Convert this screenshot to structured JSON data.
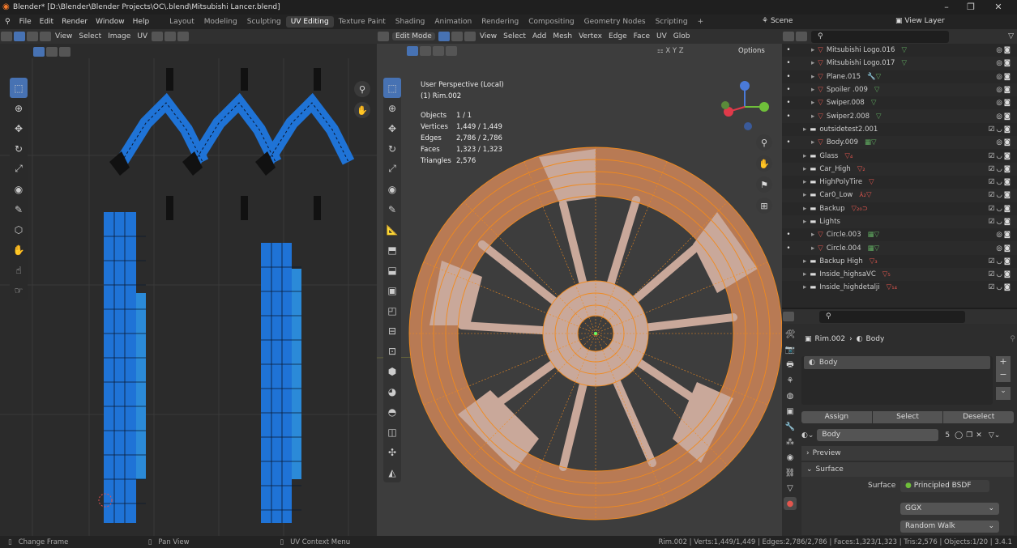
{
  "window": {
    "title": "Blender* [D:\\Blender\\Blender Projects\\OC\\.blend\\Mitsubishi Lancer.blend]",
    "minimize": "–",
    "maximize": "❐",
    "close": "✕"
  },
  "menu": {
    "items": [
      "File",
      "Edit",
      "Render",
      "Window",
      "Help"
    ]
  },
  "workspaces": [
    "Layout",
    "Modeling",
    "Sculpting",
    "UV Editing",
    "Texture Paint",
    "Shading",
    "Animation",
    "Rendering",
    "Compositing",
    "Geometry Nodes",
    "Scripting",
    "+"
  ],
  "scene": {
    "scene_label": "Scene",
    "view_layer_label": "View Layer"
  },
  "uv_editor": {
    "header": [
      "View",
      "Select",
      "Image",
      "UV"
    ]
  },
  "viewport": {
    "mode": "Edit Mode",
    "header": [
      "View",
      "Select",
      "Add",
      "Mesh",
      "Vertex",
      "Edge",
      "Face",
      "UV"
    ],
    "transform": "Glob",
    "options": "Options",
    "axes": [
      "X",
      "Y",
      "Z"
    ],
    "info_title": "User Perspective (Local)",
    "info_object": "(1) Rim.002",
    "stats": [
      {
        "label": "Objects",
        "value": "1 / 1"
      },
      {
        "label": "Vertices",
        "value": "1,449 / 1,449"
      },
      {
        "label": "Edges",
        "value": "2,786 / 2,786"
      },
      {
        "label": "Faces",
        "value": "1,323 / 1,323"
      },
      {
        "label": "Triangles",
        "value": "2,576"
      }
    ]
  },
  "outliner": {
    "rows": [
      {
        "indent": 2,
        "kind": "mesh",
        "name": "Mitsubishi Logo.016",
        "badge": "▽"
      },
      {
        "indent": 2,
        "kind": "mesh",
        "name": "Mitsubishi Logo.017",
        "badge": "▽"
      },
      {
        "indent": 2,
        "kind": "mesh",
        "name": "Plane.015",
        "badge": "🔧▽"
      },
      {
        "indent": 2,
        "kind": "mesh",
        "name": "Spoiler .009",
        "badge": "▽"
      },
      {
        "indent": 2,
        "kind": "mesh",
        "name": "Swiper.008",
        "badge": "▽"
      },
      {
        "indent": 2,
        "kind": "mesh",
        "name": "Swiper2.008",
        "badge": "▽"
      },
      {
        "indent": 1,
        "kind": "coll",
        "name": "outsidetest2.001",
        "badge": ""
      },
      {
        "indent": 2,
        "kind": "mesh",
        "name": "Body.009",
        "badge": "▦▽"
      },
      {
        "indent": 1,
        "kind": "coll",
        "name": "Glass",
        "badge": "▽₄"
      },
      {
        "indent": 1,
        "kind": "coll",
        "name": "Car_High",
        "badge": "▽₂"
      },
      {
        "indent": 1,
        "kind": "coll",
        "name": "HighPolyTire",
        "badge": "▽"
      },
      {
        "indent": 1,
        "kind": "coll",
        "name": "Car0_Low",
        "badge": "⅄₂▽"
      },
      {
        "indent": 1,
        "kind": "coll",
        "name": "Backup",
        "badge": "▽₂₀⊃"
      },
      {
        "indent": 1,
        "kind": "coll",
        "name": "Lights",
        "badge": ""
      },
      {
        "indent": 2,
        "kind": "mesh",
        "name": "Circle.003",
        "badge": "▦▽"
      },
      {
        "indent": 2,
        "kind": "mesh",
        "name": "Circle.004",
        "badge": "▦▽"
      },
      {
        "indent": 1,
        "kind": "coll",
        "name": "Backup High",
        "badge": "▽₃"
      },
      {
        "indent": 1,
        "kind": "coll",
        "name": "Inside_highsaVC",
        "badge": "▽₅"
      },
      {
        "indent": 1,
        "kind": "coll",
        "name": "Inside_highdetalji",
        "badge": "▽₁₄"
      }
    ]
  },
  "properties": {
    "breadcrumb_object": "Rim.002",
    "breadcrumb_sep": "›",
    "breadcrumb_material": "Body",
    "slot": "Body",
    "assign": "Assign",
    "select": "Select",
    "deselect": "Deselect",
    "material_name": "Body",
    "users": "5",
    "preview": "Preview",
    "surface_section": "Surface",
    "surface_label": "Surface",
    "surface_value": "Principled BSDF",
    "distribution": "GGX",
    "subsurface": "Random Walk"
  },
  "status": {
    "left1": "Change Frame",
    "left2": "Pan View",
    "left3": "UV Context Menu",
    "right": "Rim.002 | Verts:1,449/1,449 | Edges:2,786/2,786 | Faces:1,323/1,323 | Tris:2,576 | Objects:1/20 | 3.4.1"
  },
  "colors": {
    "accent": "#4772b3",
    "uv_blue": "#1f73d6",
    "mesh_orange": "#f08a1e",
    "background": "#1d1d1d"
  }
}
